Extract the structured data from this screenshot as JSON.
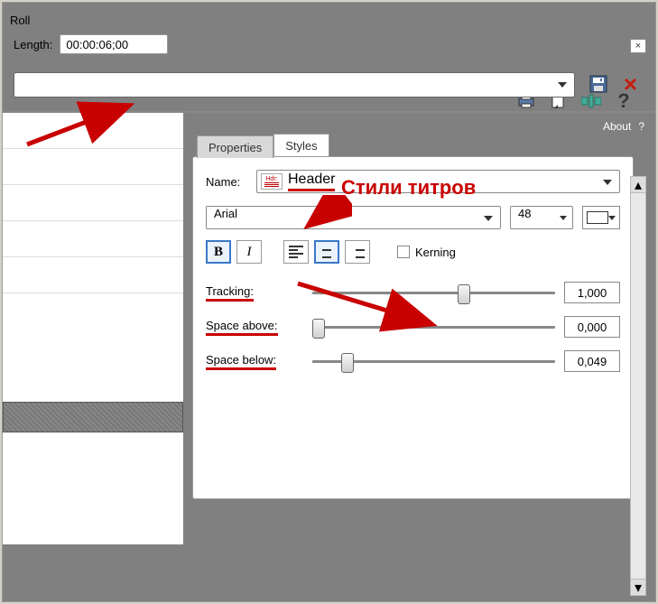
{
  "window": {
    "title": "Roll"
  },
  "length": {
    "label": "Length:",
    "value": "00:00:06;00"
  },
  "panel_header": {
    "about": "About",
    "help": "?"
  },
  "tabs": {
    "properties": "Properties",
    "styles": "Styles"
  },
  "style": {
    "name_label": "Name:",
    "name_value": "Header",
    "hdr_tag": "Hdr:",
    "font": "Arial",
    "size": "48",
    "bold": "B",
    "italic": "I",
    "kerning_label": "Kerning"
  },
  "sliders": {
    "tracking": {
      "label": "Tracking:",
      "value": "1,000",
      "pos": 60
    },
    "space_above": {
      "label": "Space above:",
      "value": "0,000",
      "pos": 0
    },
    "space_below": {
      "label": "Space below:",
      "value": "0,049",
      "pos": 12
    }
  },
  "annotations": {
    "styles_title": "Стили титров"
  }
}
